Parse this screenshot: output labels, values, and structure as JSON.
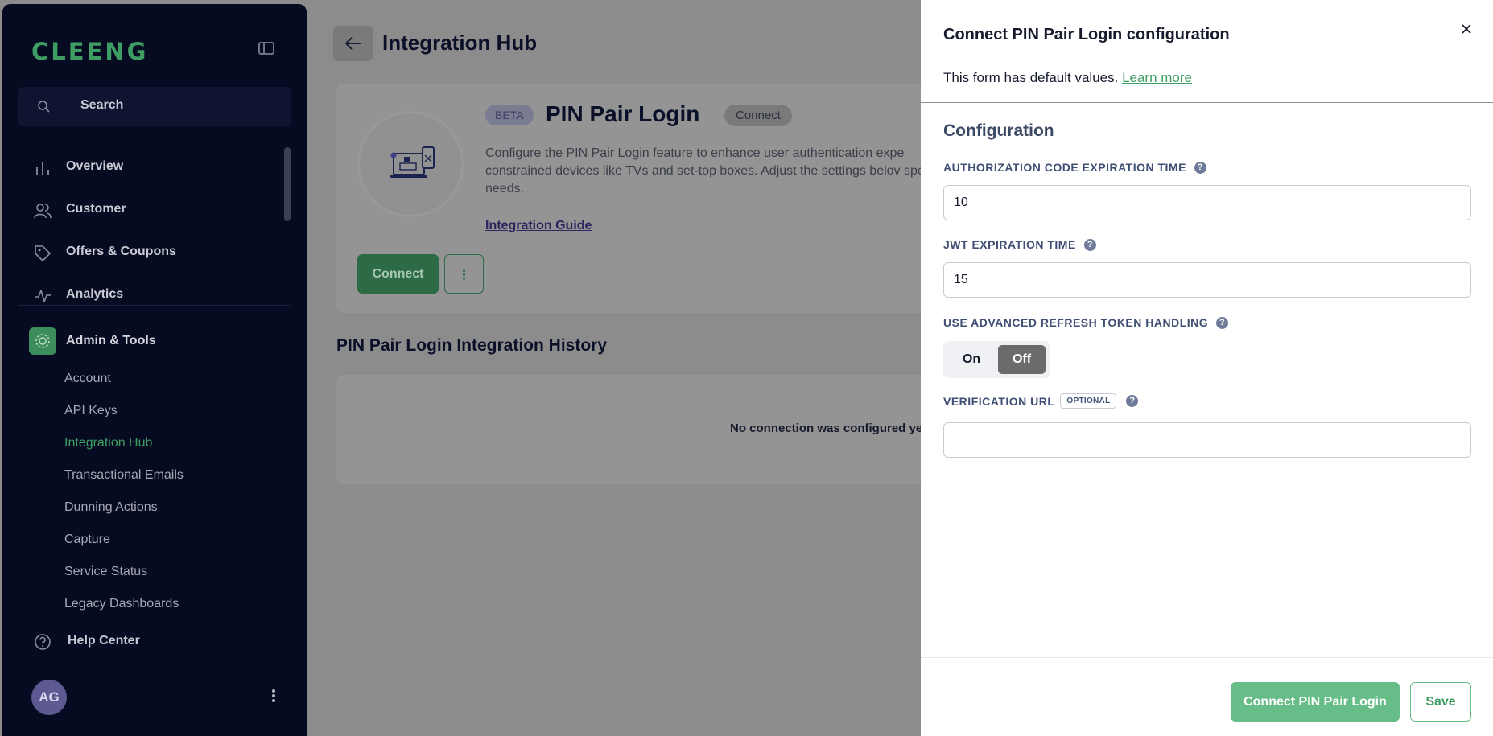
{
  "sidebar": {
    "logo": "CLEENG",
    "search_label": "Search",
    "nav": [
      {
        "label": "Overview",
        "icon": "bar-chart-icon"
      },
      {
        "label": "Customer",
        "icon": "users-icon"
      },
      {
        "label": "Offers & Coupons",
        "icon": "tag-icon"
      },
      {
        "label": "Analytics",
        "icon": "activity-icon"
      }
    ],
    "admin_label": "Admin & Tools",
    "sub_items": [
      "Account",
      "API Keys",
      "Integration Hub",
      "Transactional Emails",
      "Dunning Actions",
      "Capture",
      "Service Status",
      "Legacy Dashboards"
    ],
    "active_sub_item": "Integration Hub",
    "help_label": "Help Center",
    "avatar_initials": "AG"
  },
  "main": {
    "page_title": "Integration Hub",
    "integration": {
      "beta_badge": "BETA",
      "name": "PIN Pair Login",
      "status_badge": "Connect",
      "description": "Configure the PIN Pair Login feature to enhance user authentication expe constrained devices like TVs and set-top boxes. Adjust the settings belov specific needs.",
      "guide_link": "Integration Guide",
      "connect_label": "Connect"
    },
    "history_title": "PIN Pair Login Integration History",
    "history_empty": "No connection was configured ye"
  },
  "panel": {
    "title": "Connect PIN Pair Login configuration",
    "subtitle": "This form has default values.",
    "learn_more": "Learn more",
    "section_title": "Configuration",
    "fields": {
      "auth_code_label": "AUTHORIZATION CODE EXPIRATION TIME",
      "auth_code_value": "10",
      "jwt_label": "JWT EXPIRATION TIME",
      "jwt_value": "15",
      "refresh_label": "USE ADVANCED REFRESH TOKEN HANDLING",
      "refresh_on": "On",
      "refresh_off": "Off",
      "refresh_selected": "Off",
      "verification_label": "VERIFICATION URL",
      "optional_tag": "OPTIONAL",
      "verification_value": ""
    },
    "primary_button": "Connect PIN Pair Login",
    "secondary_button": "Save"
  },
  "colors": {
    "brand_green": "#3d9d62",
    "primary_button": "#67bd87",
    "sidebar_bg": "#060b22",
    "overlay_bg": "#8c8c8c"
  }
}
